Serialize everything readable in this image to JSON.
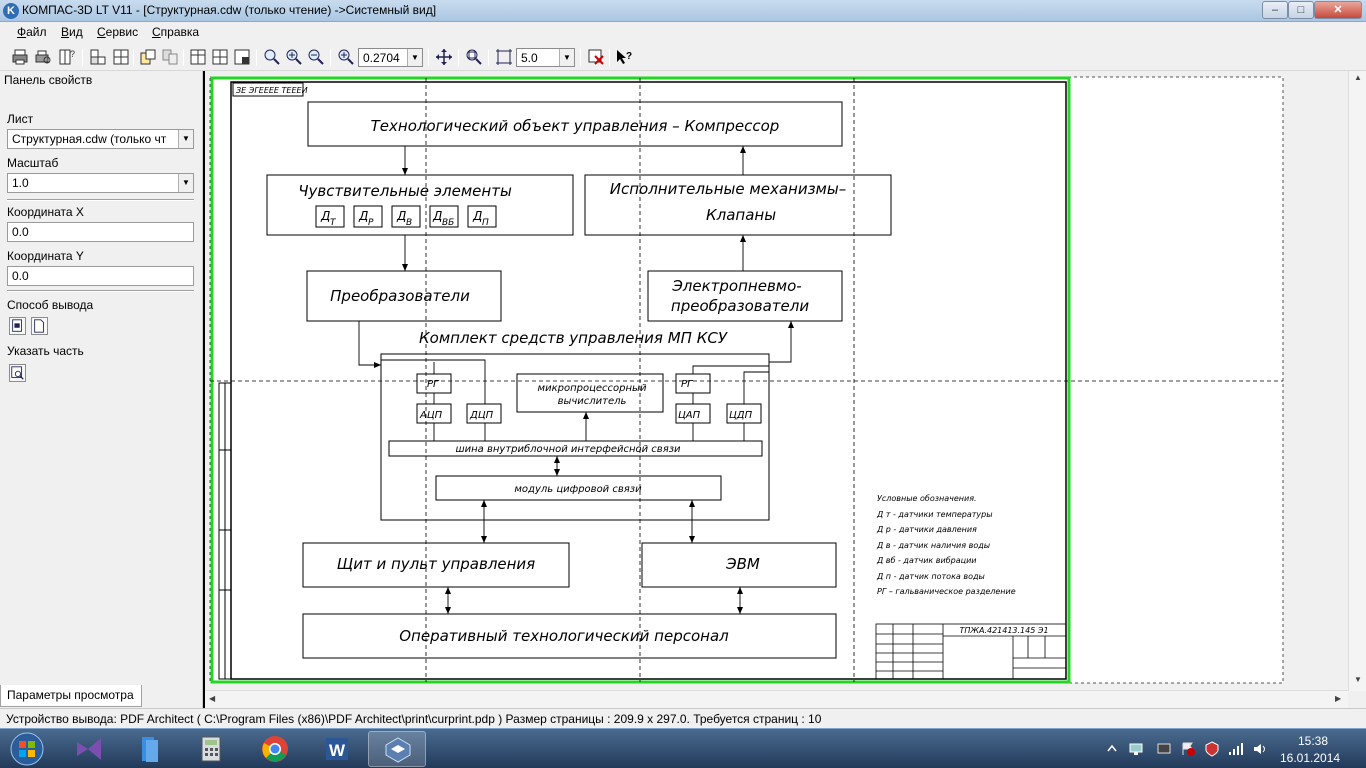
{
  "window": {
    "title": "КОМПАС-3D LT V11 - [Структурная.cdw (только чтение) ->Системный вид]",
    "app_icon_letter": "K",
    "min_glyph": "–",
    "max_glyph": "□",
    "close_glyph": "✕"
  },
  "menu": [
    "Файл",
    "Вид",
    "Сервис",
    "Справка"
  ],
  "toolbar": {
    "scale": "0.2704",
    "step": "5.0"
  },
  "panel": {
    "header": "Панель свойств",
    "sheet_label": "Лист",
    "sheet_value": "Структурная.cdw (только чт",
    "scale_label": "Масштаб",
    "scale_value": "1.0",
    "x_label": "Координата X",
    "x_value": "0.0",
    "y_label": "Координата Y",
    "y_value": "0.0",
    "output_label": "Способ вывода",
    "part_label": "Указать часть",
    "tab": "Параметры просмотра"
  },
  "drawing": {
    "stamp_top": "ЗЕ ЭГЕЕЕЕ ТЕЕЕИ",
    "plant": "Технологический объект управления – Компрессор",
    "sensors": "Чувствительные элементы",
    "sensor_items": [
      "Д",
      "Д",
      "Д",
      "Д",
      "Д"
    ],
    "sensor_subs": [
      "T",
      "P",
      "B",
      "BБ",
      "П"
    ],
    "actuators_1": "Исполнительные механизмы–",
    "actuators_2": "Клапаны",
    "converters": "Преобразователи",
    "epc_1": "Электропневмо-",
    "epc_2": "преобразователи",
    "complex": "Комплект средств управления  МП КСУ",
    "rg": "РГ",
    "adc": "АЦП",
    "dcp": "ДЦП",
    "dac": "ЦАП",
    "cdp": "ЦДП",
    "cpu_1": "микропроцессорный",
    "cpu_2": "вычислитель",
    "bus": "шина внутриблочной интерфейсной связи",
    "digital": "модуль цифровой связи",
    "panel_board": "Щит и пульт управления",
    "computer": "ЭВМ",
    "personnel": "Оперативный технологический персонал",
    "legend": [
      "Условные обозначения.",
      "Д т - датчики температуры",
      "Д р - датчики давления",
      "Д в - датчик наличия воды",
      "Д вб - датчик вибрации",
      "Д п - датчик потока воды",
      "РГ – гальваническое разделение"
    ],
    "title_code": "ТПЖА.421413.145 Э1"
  },
  "statusbar": "Устройство вывода: PDF Architect ( C:\\Program Files (x86)\\PDF Architect\\print\\curprint.pdp )  Размер страницы : 209.9 x 297.0.  Требуется страниц : 10",
  "taskbar": {
    "time": "15:38",
    "date": "16.01.2014"
  },
  "colors": {
    "sheet_border": "#22d822",
    "taskbar": "#2c4a6e"
  }
}
